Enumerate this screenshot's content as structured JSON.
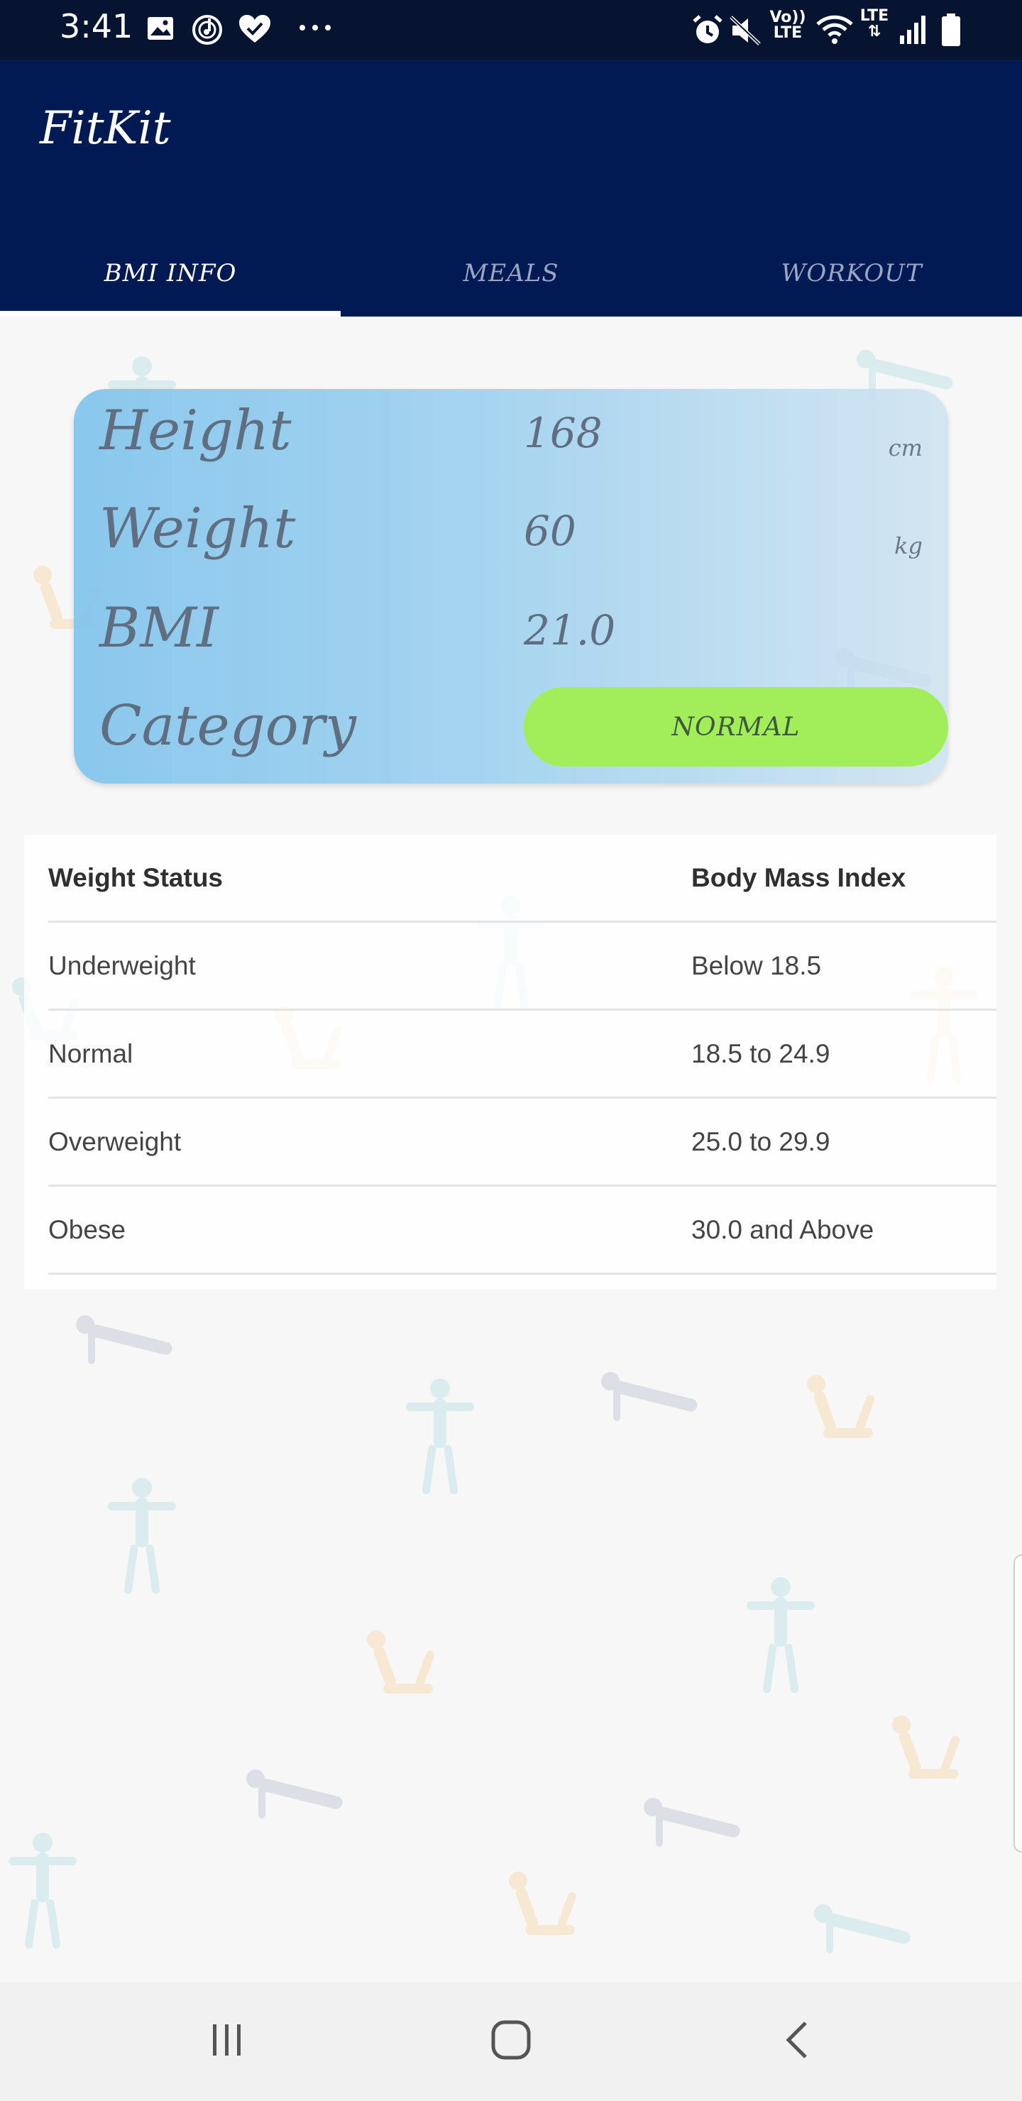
{
  "status_bar": {
    "time": "3:41",
    "left_icons": [
      "image-icon",
      "music-icon",
      "heart-check-icon",
      "more-dots-icon"
    ],
    "right_icons": [
      "alarm-icon",
      "mute-icon",
      "volte-icon",
      "wifi-icon",
      "lte-icon",
      "signal-icon",
      "battery-icon"
    ],
    "volte_label_1": "Vo))",
    "volte_label_2": "LTE",
    "lte_label": "LTE"
  },
  "app": {
    "title": "FitKit",
    "tabs": [
      {
        "label": "BMI INFO",
        "active": true
      },
      {
        "label": "MEALS",
        "active": false
      },
      {
        "label": "WORKOUT",
        "active": false
      }
    ]
  },
  "bmi_card": {
    "height": {
      "label": "Height",
      "value": "168",
      "unit": "cm"
    },
    "weight": {
      "label": "Weight",
      "value": "60",
      "unit": "kg"
    },
    "bmi": {
      "label": "BMI",
      "value": "21.0"
    },
    "category": {
      "label": "Category",
      "value": "NORMAL"
    }
  },
  "bmi_table": {
    "headers": [
      "Weight Status",
      "Body Mass Index"
    ],
    "rows": [
      [
        "Underweight",
        "Below 18.5"
      ],
      [
        "Normal",
        "18.5 to 24.9"
      ],
      [
        "Overweight",
        "25.0 to 29.9"
      ],
      [
        "Obese",
        "30.0 and Above"
      ]
    ]
  },
  "nav_bar": {
    "buttons": [
      "recent-apps-icon",
      "home-icon",
      "back-icon"
    ]
  },
  "colors": {
    "status_bar": "#061331",
    "app_bar": "#021a53",
    "category_pill": "#a1ee5a",
    "card_text": "#5f6e80"
  }
}
